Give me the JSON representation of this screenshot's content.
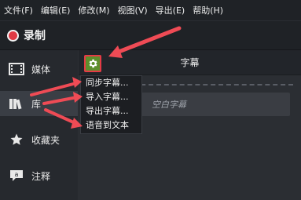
{
  "menubar": {
    "items": [
      "文件(F)",
      "编辑(E)",
      "修改(M)",
      "视图(V)",
      "导出(E)",
      "帮助(H)"
    ]
  },
  "record": {
    "label": "录制",
    "icon": "record-dot-icon",
    "color": "#e03a44"
  },
  "sidebar": {
    "items": [
      {
        "label": "媒体",
        "icon": "film-icon"
      },
      {
        "label": "库",
        "icon": "library-books-icon"
      },
      {
        "label": "收藏夹",
        "icon": "star-icon"
      },
      {
        "label": "注释",
        "icon": "annotation-icon"
      }
    ]
  },
  "panel": {
    "title": "字幕",
    "settings_icon": "gear-icon",
    "caption_placeholder": "空白字幕"
  },
  "dropdown": {
    "items": [
      "同步字幕...",
      "导入字幕...",
      "导出字幕...",
      "语音到文本"
    ]
  },
  "colors": {
    "accent_green": "#5d8f2c",
    "highlight_red": "#e63b46",
    "arrow_red": "#ef4b55"
  }
}
